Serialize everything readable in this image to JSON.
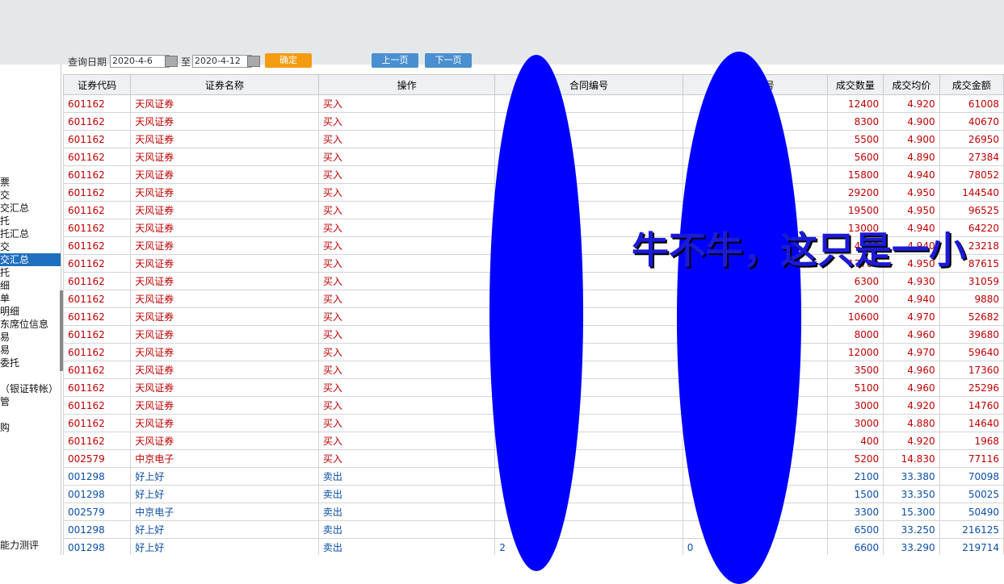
{
  "sidebar": {
    "items": [
      {
        "label": "票",
        "selected": false
      },
      {
        "label": "交",
        "selected": false
      },
      {
        "label": "交汇总",
        "selected": false
      },
      {
        "label": "托",
        "selected": false
      },
      {
        "label": "托汇总",
        "selected": false
      },
      {
        "label": "交",
        "selected": false
      },
      {
        "label": "交汇总",
        "selected": true
      },
      {
        "label": "托",
        "selected": false
      },
      {
        "label": "细",
        "selected": false
      },
      {
        "label": "  单",
        "selected": false
      },
      {
        "label": "明细",
        "selected": false
      },
      {
        "label": "东席位信息",
        "selected": false
      },
      {
        "label": "易",
        "selected": false
      },
      {
        "label": "易",
        "selected": false
      },
      {
        "label": "委托",
        "selected": false
      },
      {
        "label": "（银证转帐）",
        "selected": false
      },
      {
        "label": "管",
        "selected": false
      },
      {
        "label": "购",
        "selected": false
      },
      {
        "label": "能力测评",
        "selected": false
      }
    ]
  },
  "toolbar": {
    "query_date_label": "查询日期",
    "start_date": "2020-4-6",
    "to_label": "至",
    "end_date": "2020-4-12",
    "query_button": "确定",
    "prev_week_button": "上一页",
    "next_week_button": "下一页"
  },
  "table": {
    "headers": [
      "证券代码",
      "证券名称",
      "操作",
      "合同编号",
      "成交编号",
      "成交数量",
      "成交均价",
      "成交金额"
    ],
    "rows": [
      {
        "side": "buy",
        "code": "601162",
        "name": "天风证券",
        "op": "买入",
        "contract": "",
        "deal": "",
        "qty": "12400",
        "price": "4.920",
        "amount": "61008"
      },
      {
        "side": "buy",
        "code": "601162",
        "name": "天风证券",
        "op": "买入",
        "contract": "",
        "deal": "",
        "qty": "8300",
        "price": "4.900",
        "amount": "40670"
      },
      {
        "side": "buy",
        "code": "601162",
        "name": "天风证券",
        "op": "买入",
        "contract": "",
        "deal": "",
        "qty": "5500",
        "price": "4.900",
        "amount": "26950"
      },
      {
        "side": "buy",
        "code": "601162",
        "name": "天风证券",
        "op": "买入",
        "contract": "",
        "deal": "",
        "qty": "5600",
        "price": "4.890",
        "amount": "27384"
      },
      {
        "side": "buy",
        "code": "601162",
        "name": "天风证券",
        "op": "买入",
        "contract": "",
        "deal": "",
        "qty": "15800",
        "price": "4.940",
        "amount": "78052"
      },
      {
        "side": "buy",
        "code": "601162",
        "name": "天风证券",
        "op": "买入",
        "contract": "",
        "deal": "",
        "qty": "29200",
        "price": "4.950",
        "amount": "144540"
      },
      {
        "side": "buy",
        "code": "601162",
        "name": "天风证券",
        "op": "买入",
        "contract": "",
        "deal": "",
        "qty": "19500",
        "price": "4.950",
        "amount": "96525"
      },
      {
        "side": "buy",
        "code": "601162",
        "name": "天风证券",
        "op": "买入",
        "contract": "",
        "deal": "",
        "qty": "13000",
        "price": "4.940",
        "amount": "64220"
      },
      {
        "side": "buy",
        "code": "601162",
        "name": "天风证券",
        "op": "买入",
        "contract": "",
        "deal": "",
        "qty": "4700",
        "price": "4.940",
        "amount": "23218"
      },
      {
        "side": "buy",
        "code": "601162",
        "name": "天风证券",
        "op": "买入",
        "contract": "",
        "deal": "",
        "qty": "17700",
        "price": "4.950",
        "amount": "87615"
      },
      {
        "side": "buy",
        "code": "601162",
        "name": "天风证券",
        "op": "买入",
        "contract": "",
        "deal": "",
        "qty": "6300",
        "price": "4.930",
        "amount": "31059"
      },
      {
        "side": "buy",
        "code": "601162",
        "name": "天风证券",
        "op": "买入",
        "contract": "",
        "deal": "",
        "qty": "2000",
        "price": "4.940",
        "amount": "9880"
      },
      {
        "side": "buy",
        "code": "601162",
        "name": "天风证券",
        "op": "买入",
        "contract": "",
        "deal": "",
        "qty": "10600",
        "price": "4.970",
        "amount": "52682"
      },
      {
        "side": "buy",
        "code": "601162",
        "name": "天风证券",
        "op": "买入",
        "contract": "",
        "deal": "",
        "qty": "8000",
        "price": "4.960",
        "amount": "39680"
      },
      {
        "side": "buy",
        "code": "601162",
        "name": "天风证券",
        "op": "买入",
        "contract": "",
        "deal": "",
        "qty": "12000",
        "price": "4.970",
        "amount": "59640"
      },
      {
        "side": "buy",
        "code": "601162",
        "name": "天风证券",
        "op": "买入",
        "contract": "",
        "deal": "",
        "qty": "3500",
        "price": "4.960",
        "amount": "17360"
      },
      {
        "side": "buy",
        "code": "601162",
        "name": "天风证券",
        "op": "买入",
        "contract": "",
        "deal": "",
        "qty": "5100",
        "price": "4.960",
        "amount": "25296"
      },
      {
        "side": "buy",
        "code": "601162",
        "name": "天风证券",
        "op": "买入",
        "contract": "",
        "deal": "",
        "qty": "3000",
        "price": "4.920",
        "amount": "14760"
      },
      {
        "side": "buy",
        "code": "601162",
        "name": "天风证券",
        "op": "买入",
        "contract": "",
        "deal": "",
        "qty": "3000",
        "price": "4.880",
        "amount": "14640"
      },
      {
        "side": "buy",
        "code": "601162",
        "name": "天风证券",
        "op": "买入",
        "contract": "",
        "deal": "",
        "qty": "400",
        "price": "4.920",
        "amount": "1968"
      },
      {
        "side": "buy",
        "code": "002579",
        "name": "中京电子",
        "op": "买入",
        "contract": "",
        "deal": "",
        "qty": "5200",
        "price": "14.830",
        "amount": "77116"
      },
      {
        "side": "sell",
        "code": "001298",
        "name": "好上好",
        "op": "卖出",
        "contract": "",
        "deal": "",
        "qty": "2100",
        "price": "33.380",
        "amount": "70098"
      },
      {
        "side": "sell",
        "code": "001298",
        "name": "好上好",
        "op": "卖出",
        "contract": "",
        "deal": "",
        "qty": "1500",
        "price": "33.350",
        "amount": "50025"
      },
      {
        "side": "sell",
        "code": "002579",
        "name": "中京电子",
        "op": "卖出",
        "contract": "",
        "deal": "",
        "qty": "3300",
        "price": "15.300",
        "amount": "50490"
      },
      {
        "side": "sell",
        "code": "001298",
        "name": "好上好",
        "op": "卖出",
        "contract": "",
        "deal": "",
        "qty": "6500",
        "price": "33.250",
        "amount": "216125"
      },
      {
        "side": "sell",
        "code": "001298",
        "name": "好上好",
        "op": "卖出",
        "contract": "2",
        "deal": "0",
        "qty": "6600",
        "price": "33.290",
        "amount": "219714"
      }
    ]
  },
  "overlay": {
    "caption": "牛不牛，这只是一小",
    "color": "#0000ff"
  },
  "colors": {
    "buy_text": "#c00000",
    "sell_text": "#0a4ea8",
    "selected_bg": "#1f6fbf",
    "query_button": "#f39c12"
  }
}
